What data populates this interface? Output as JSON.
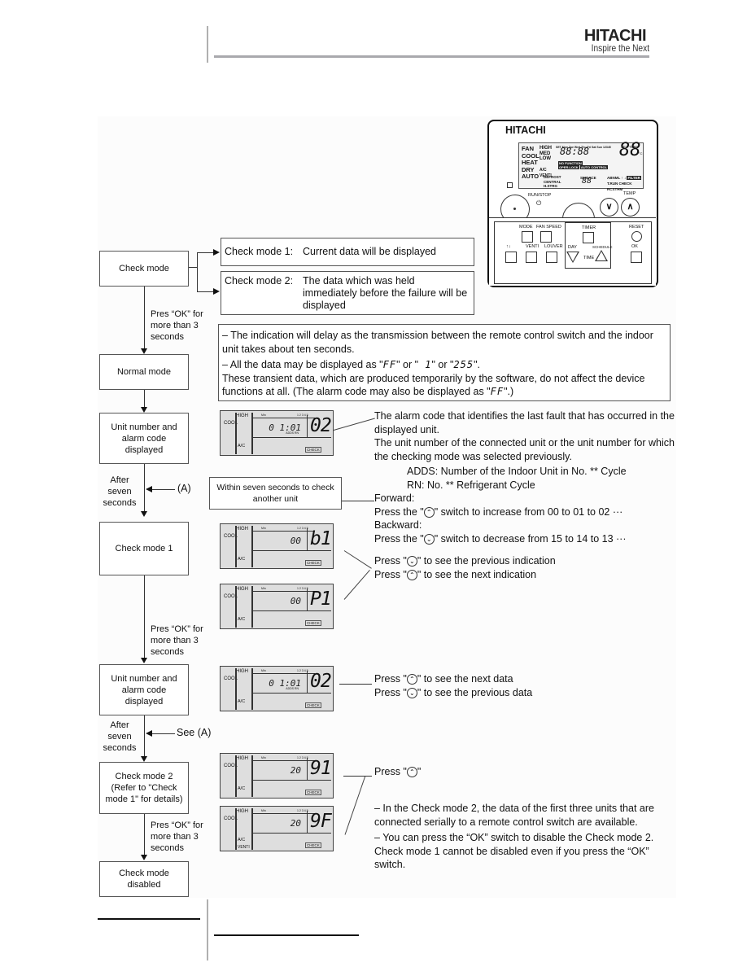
{
  "header": {
    "logo": "HITACHI",
    "tagline": "Inspire the Next"
  },
  "remote": {
    "brand": "HITACHI",
    "modes": [
      "FAN",
      "COOL",
      "HEAT",
      "DRY",
      "AUTO"
    ],
    "fan_levels": [
      "HIGH",
      "MED",
      "LOW"
    ],
    "days": "SET Mon Tue Wed Thu Fri Sat Sun 12345",
    "clock": "88:88",
    "set_temp_label": "SET TEMP",
    "set_temp": "88",
    "temp_unit": "°C",
    "ac_venti": [
      "A/C",
      "VENTI"
    ],
    "status_left": [
      "DEFROST",
      "CENTRAL",
      "H.STRG"
    ],
    "service_label": "SERVICE",
    "service_value": "88",
    "indicators_row1": [
      "ABNML",
      "↑ ↓",
      "FILTER"
    ],
    "indicators_row2": [
      "T.RUN",
      "CHECK",
      "RCSTHM"
    ],
    "function_labels": [
      "NO FUNCTION",
      "OPER.LOCK",
      "AUTO CONTROL"
    ],
    "run_stop_label": "RUN/STOP",
    "power_icon": "⏻",
    "temp_label": "TEMP",
    "temp_down": "∨",
    "temp_up": "∧",
    "buttons": {
      "mode": "MODE",
      "fan_speed": "FAN SPEED",
      "timer": "TIMER",
      "reset": "RESET",
      "louver_arrows": "↑↓",
      "venti": "VENTI",
      "louver": "LOUVER",
      "day": "DAY",
      "time": "TIME",
      "schedule": "SCHEDULE",
      "ok": "OK"
    }
  },
  "flow": {
    "check_mode": "Check mode",
    "press_ok_1": "Pres “OK” for more than 3 seconds",
    "normal_mode": "Normal mode",
    "unit_alarm_1": "Unit number and alarm code displayed",
    "after_seven_1": "After seven seconds",
    "ref_a": "(A)",
    "check_mode_1": "Check mode 1",
    "press_ok_2": "Pres “OK” for more than 3 seconds",
    "unit_alarm_2": "Unit number and alarm code displayed",
    "after_seven_2": "After seven seconds",
    "see_a": "See (A)",
    "check_mode_2": "Check mode 2 (Refer to \"Check mode 1\" for details)",
    "press_ok_3": "Pres “OK” for more than 3 seconds",
    "check_mode_disabled": "Check mode disabled"
  },
  "mode_boxes": [
    {
      "label": "Check mode 1:",
      "desc": "Current data will be displayed"
    },
    {
      "label": "Check mode 2:",
      "desc": "The data which was held immediately before the failure will be displayed"
    }
  ],
  "notes_box": {
    "line1": "–    The indication will delay as the transmission between the remote control switch and the indoor unit takes about ten seconds.",
    "line2_pre": "–    All the data may be displayed as \"",
    "seg_ff": "FF",
    "line2_mid1": "\" or \"",
    "seg_1": " 1",
    "line2_mid2": "\" or \"",
    "seg_255": "255",
    "line2_post": "\".",
    "line3_pre": "These transient data, which are produced temporarily by the software, do not affect the device functions at all. (The alarm code may also be displayed as \"",
    "line3_post": "\".)"
  },
  "within_box": "Within seven seconds to check another unit",
  "alarm_text": {
    "line1": "The alarm code that identifies the last fault that has occurred in the displayed unit.",
    "line2": "The unit number of the connected unit or the unit number for which the checking mode was selected previously.",
    "adds": "ADDS: Number of the Indoor Unit in No. ** Cycle",
    "rn": "RN: No. ** Refrigerant Cycle",
    "forward": "Forward:",
    "forward_desc_pre": "Press the \"",
    "forward_desc_post": "\" switch to increase from 00 to 01 to 02 ···",
    "backward": "Backward:",
    "backward_desc_pre": "Press the \"",
    "backward_desc_post": "\" switch to decrease from 15 to 14 to 13 ···"
  },
  "indication_text": {
    "prev_pre": "Press \"",
    "prev_post": "\" to see the previous indication",
    "next_pre": "Press \"",
    "next_post": "\" to see the next indication"
  },
  "data_text": {
    "next_pre": "Press \"",
    "next_post": "\" to see the next data",
    "prev_pre": "Press \"",
    "prev_post": "\" to see the previous data"
  },
  "mode2_text": {
    "press_pre": "Press \"",
    "press_post": "\"",
    "note1": "–    In the Check mode 2, the data of the first three units that are connected serially to a remote control switch are available.",
    "note2": "–    You can press the “OK” switch to disable the Check mode 2. Check mode 1 cannot be disabled even if you press the “OK” switch."
  },
  "symbols": {
    "up": "^",
    "down": "v"
  },
  "lcds": [
    {
      "small": "0 1:01",
      "sub": "ADDS RN",
      "big": "02",
      "venti": false
    },
    {
      "small": "00",
      "sub": "",
      "big": "b1",
      "venti": false
    },
    {
      "small": "00",
      "sub": "",
      "big": "P1",
      "venti": false
    },
    {
      "small": "0 1:01",
      "sub": "ADDS RN",
      "big": "02",
      "venti": false
    },
    {
      "small": "20",
      "sub": "",
      "big": "91",
      "venti": false
    },
    {
      "small": "20",
      "sub": "",
      "big": "9F",
      "venti": true
    }
  ],
  "lcd_labels": {
    "cool": "COOL",
    "high": "HIGH",
    "ac": "A/C",
    "venti": "VENTI",
    "min": "Min",
    "nums": "1 2 3 4 5",
    "check": "CHECK"
  }
}
